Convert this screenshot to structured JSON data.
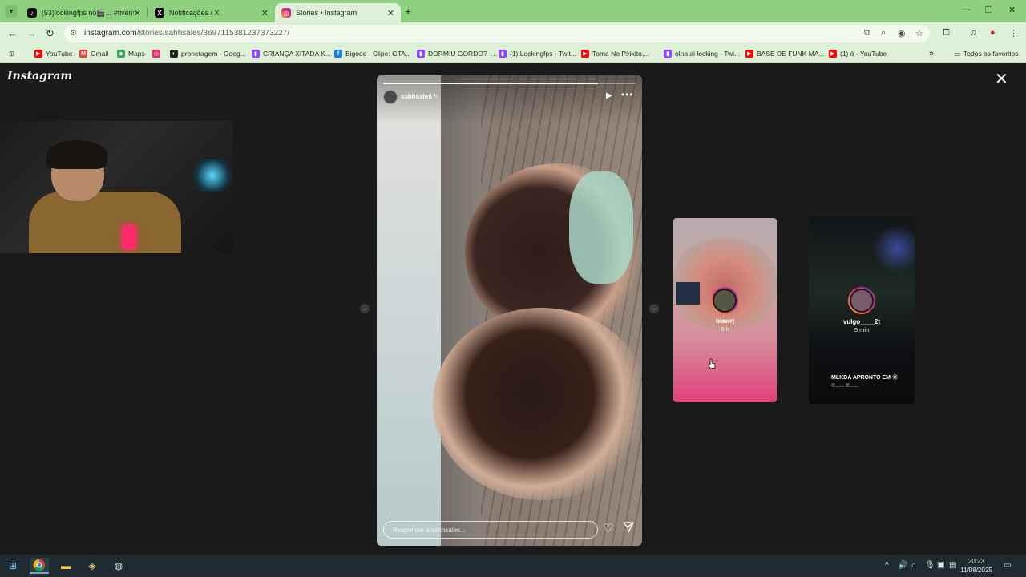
{
  "browser": {
    "tabs": [
      {
        "label": "(53)lockingfps no🎬... #fivem",
        "icon": "tiktok-icon",
        "active": false
      },
      {
        "label": "Notificações / X",
        "icon": "x-icon",
        "active": false
      },
      {
        "label": "Stories • Instagram",
        "icon": "instagram-icon",
        "active": true
      }
    ],
    "address": {
      "domain": "instagram.com",
      "path": "/stories/sahhsales/3697115381237373227/"
    },
    "bookmarks": [
      {
        "label": "YouTube",
        "icon": "youtube-icon",
        "color": "#ff0000"
      },
      {
        "label": "Gmail",
        "icon": "gmail-icon",
        "color": "#ea4335"
      },
      {
        "label": "Maps",
        "icon": "maps-icon",
        "color": "#34a853"
      },
      {
        "label": "",
        "icon": "instagram-icon",
        "color": "#e1306c"
      },
      {
        "label": "pronetagem - Goog...",
        "icon": "globe-icon",
        "color": "#222222"
      },
      {
        "label": "CRIANÇA XITADA K...",
        "icon": "twitch-icon",
        "color": "#9146ff"
      },
      {
        "label": "Bigode - Clipe: GTA...",
        "icon": "facebook-icon",
        "color": "#1877f2"
      },
      {
        "label": "DORMIU GORDO? -...",
        "icon": "twitch-icon",
        "color": "#9146ff"
      },
      {
        "label": "(1) Lockingfps - Twit...",
        "icon": "twitch-icon",
        "color": "#9146ff"
      },
      {
        "label": "Toma No Pirikito,...",
        "icon": "youtube-icon",
        "color": "#ff0000"
      },
      {
        "label": "olha ai locking - Twi...",
        "icon": "twitch-icon",
        "color": "#9146ff"
      },
      {
        "label": "BASE DE FUNK MA...",
        "icon": "youtube-icon",
        "color": "#ff0000"
      },
      {
        "label": "(1) ó - YouTube",
        "icon": "youtube-icon",
        "color": "#ff0000"
      }
    ],
    "bookmarks_more": "»",
    "all_bookmarks": "Todos os favoritos"
  },
  "instagram": {
    "logo": "Instagram",
    "story": {
      "username": "sahhsales",
      "time": "1 h",
      "progress": 0.85,
      "reply_placeholder": "Responder a sahhsales..."
    },
    "next_stories": [
      {
        "username": "biawrj",
        "time": "8 h"
      },
      {
        "username": "vulgo____2t",
        "time": "5 min",
        "caption": "MLKDA APRONTO EM 😝",
        "caption_sub": "@____ @____"
      }
    ]
  },
  "taskbar": {
    "time": "20:23",
    "date": "11/08/2025"
  }
}
